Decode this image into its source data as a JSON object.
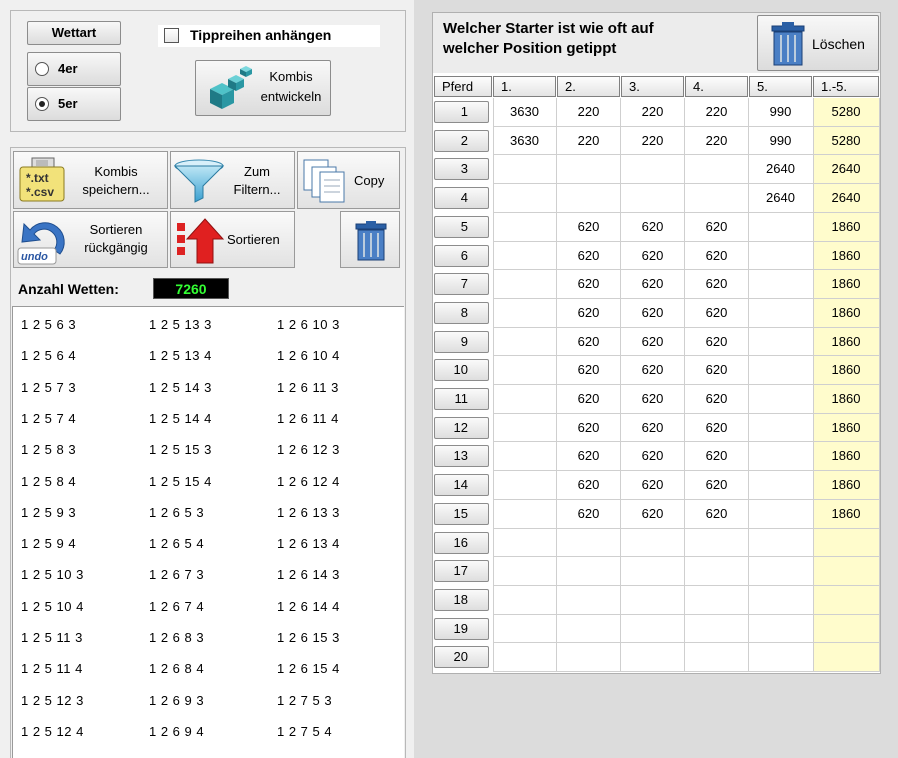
{
  "wettart": {
    "title": "Wettart",
    "option_4er": "4er",
    "option_5er": "5er",
    "selected": "5er"
  },
  "tippreihen": {
    "label": "Tippreihen anhängen",
    "checked": false
  },
  "kombis_entwickeln": {
    "line1": "Kombis",
    "line2": "entwickeln"
  },
  "toolbar": {
    "save_line1": "Kombis",
    "save_line2": "speichern...",
    "filter_line1": "Zum",
    "filter_line2": "Filtern...",
    "copy": "Copy",
    "undo_line1": "Sortieren",
    "undo_line2": "rückgängig",
    "sort": "Sortieren",
    "save_icon_text1": "*.txt",
    "save_icon_text2": "*.csv",
    "undo_icon_text": "undo"
  },
  "anzahl": {
    "label": "Anzahl Wetten:",
    "value": "7260"
  },
  "list_rows": [
    [
      "1 2 5 6 3",
      "1 2 5 13 3",
      "1 2 6 10 3"
    ],
    [
      "1 2 5 6 4",
      "1 2 5 13 4",
      "1 2 6 10 4"
    ],
    [
      "1 2 5 7 3",
      "1 2 5 14 3",
      "1 2 6 11 3"
    ],
    [
      "1 2 5 7 4",
      "1 2 5 14 4",
      "1 2 6 11 4"
    ],
    [
      "1 2 5 8 3",
      "1 2 5 15 3",
      "1 2 6 12 3"
    ],
    [
      "1 2 5 8 4",
      "1 2 5 15 4",
      "1 2 6 12 4"
    ],
    [
      "1 2 5 9 3",
      "1 2 6 5 3",
      "1 2 6 13 3"
    ],
    [
      "1 2 5 9 4",
      "1 2 6 5 4",
      "1 2 6 13 4"
    ],
    [
      "1 2 5 10 3",
      "1 2 6 7 3",
      "1 2 6 14 3"
    ],
    [
      "1 2 5 10 4",
      "1 2 6 7 4",
      "1 2 6 14 4"
    ],
    [
      "1 2 5 11 3",
      "1 2 6 8 3",
      "1 2 6 15 3"
    ],
    [
      "1 2 5 11 4",
      "1 2 6 8 4",
      "1 2 6 15 4"
    ],
    [
      "1 2 5 12 3",
      "1 2 6 9 3",
      "1 2 7 5 3"
    ],
    [
      "1 2 5 12 4",
      "1 2 6 9 4",
      "1 2 7 5 4"
    ]
  ],
  "stats": {
    "title_line1": "Welcher Starter ist wie oft auf",
    "title_line2": "welcher Position getippt",
    "delete_label": "Löschen",
    "headers": [
      "Pferd",
      "1.",
      "2.",
      "3.",
      "4.",
      "5.",
      "1.-5."
    ],
    "rows": [
      [
        "1",
        "3630",
        "220",
        "220",
        "220",
        "990",
        "5280"
      ],
      [
        "2",
        "3630",
        "220",
        "220",
        "220",
        "990",
        "5280"
      ],
      [
        "3",
        "",
        "",
        "",
        "",
        "2640",
        "2640"
      ],
      [
        "4",
        "",
        "",
        "",
        "",
        "2640",
        "2640"
      ],
      [
        "5",
        "",
        "620",
        "620",
        "620",
        "",
        "1860"
      ],
      [
        "6",
        "",
        "620",
        "620",
        "620",
        "",
        "1860"
      ],
      [
        "7",
        "",
        "620",
        "620",
        "620",
        "",
        "1860"
      ],
      [
        "8",
        "",
        "620",
        "620",
        "620",
        "",
        "1860"
      ],
      [
        "9",
        "",
        "620",
        "620",
        "620",
        "",
        "1860"
      ],
      [
        "10",
        "",
        "620",
        "620",
        "620",
        "",
        "1860"
      ],
      [
        "11",
        "",
        "620",
        "620",
        "620",
        "",
        "1860"
      ],
      [
        "12",
        "",
        "620",
        "620",
        "620",
        "",
        "1860"
      ],
      [
        "13",
        "",
        "620",
        "620",
        "620",
        "",
        "1860"
      ],
      [
        "14",
        "",
        "620",
        "620",
        "620",
        "",
        "1860"
      ],
      [
        "15",
        "",
        "620",
        "620",
        "620",
        "",
        "1860"
      ],
      [
        "16",
        "",
        "",
        "",
        "",
        "",
        ""
      ],
      [
        "17",
        "",
        "",
        "",
        "",
        "",
        ""
      ],
      [
        "18",
        "",
        "",
        "",
        "",
        "",
        ""
      ],
      [
        "19",
        "",
        "",
        "",
        "",
        "",
        ""
      ],
      [
        "20",
        "",
        "",
        "",
        "",
        "",
        ""
      ]
    ]
  },
  "colors": {
    "accent_yellow": "#fffccc",
    "counter_bg": "#000000",
    "counter_fg": "#33ff33",
    "trash_blue": "#3a6fb0"
  }
}
